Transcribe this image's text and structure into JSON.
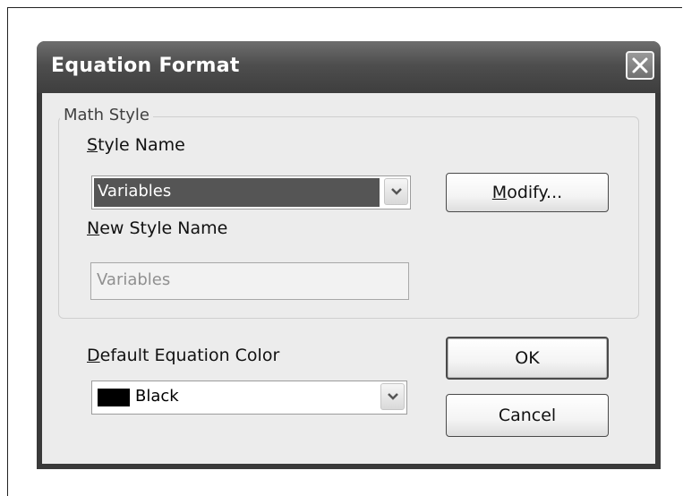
{
  "dialog": {
    "title": "Equation Format"
  },
  "math_style": {
    "group_label": "Math Style",
    "style_name_label_mnemonic": "S",
    "style_name_label_rest": "tyle Name",
    "style_name_value": "Variables",
    "new_style_name_label_mnemonic": "N",
    "new_style_name_label_rest": "ew Style Name",
    "new_style_name_value": "Variables",
    "modify_mnemonic": "M",
    "modify_rest": "odify..."
  },
  "equation_color": {
    "label_mnemonic": "D",
    "label_rest": "efault Equation Color",
    "value": "Black",
    "swatch_color": "#000000"
  },
  "buttons": {
    "ok": "OK",
    "cancel": "Cancel"
  }
}
